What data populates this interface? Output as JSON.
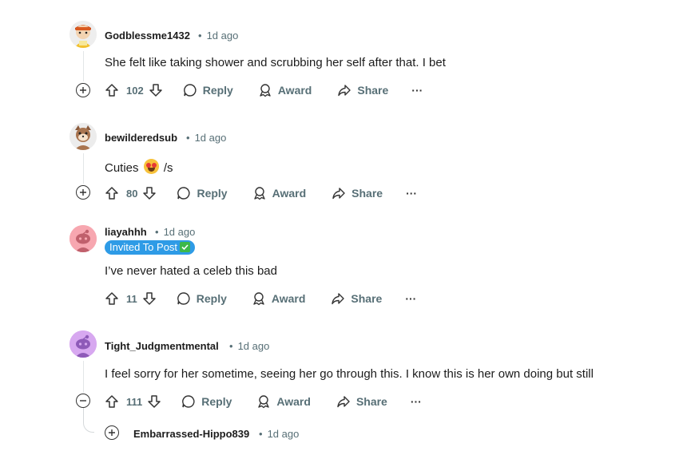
{
  "comments": [
    {
      "username": "Godblessme1432",
      "age": "1d ago",
      "text": "She felt like taking shower and scrubbing her self after that. I bet",
      "score": "102",
      "toggle": "expand"
    },
    {
      "username": "bewilderedsub",
      "age": "1d ago",
      "text_before_emoji": "Cuties",
      "text_after_emoji": "/s",
      "emoji": "heart-eyes-emoji",
      "score": "80",
      "toggle": "expand"
    },
    {
      "username": "liayahhh",
      "age": "1d ago",
      "flair": "Invited To Post",
      "flair_color": "#2e9be6",
      "text": "I’ve never hated a celeb this bad",
      "score": "11"
    },
    {
      "username": "Tight_Judgmentmental",
      "age": "1d ago",
      "text": "I feel sorry for her sometime, seeing her go through this. I know this is her own doing but still",
      "score": "111",
      "toggle": "collapse"
    },
    {
      "username": "Embarrassed-Hippo839",
      "age": "1d ago",
      "toggle": "expand"
    }
  ],
  "actions": {
    "reply": "Reply",
    "award": "Award",
    "share": "Share",
    "more": "···"
  },
  "separator": "•",
  "colors": {
    "text": "#1c1c1c",
    "muted": "#576f76",
    "thread_line": "#e3e6e8",
    "flair_bg": "#2e9be6"
  }
}
